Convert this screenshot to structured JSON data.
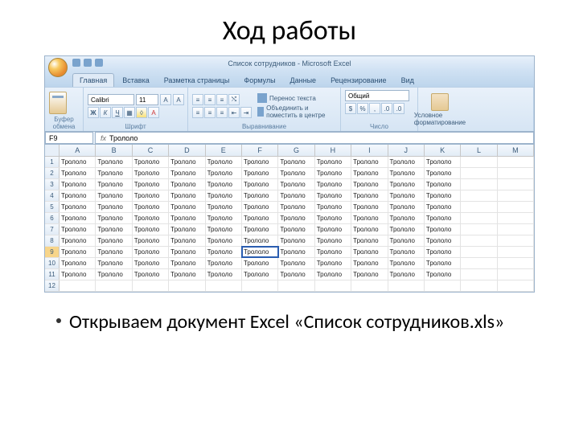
{
  "slide": {
    "title": "Ход работы",
    "bullet": "Открываем документ Excel «Список сотрудников.xls»"
  },
  "window": {
    "title": "Список сотрудников - Microsoft Excel"
  },
  "tabs": {
    "items": [
      {
        "label": "Главная",
        "active": true
      },
      {
        "label": "Вставка",
        "active": false
      },
      {
        "label": "Разметка страницы",
        "active": false
      },
      {
        "label": "Формулы",
        "active": false
      },
      {
        "label": "Данные",
        "active": false
      },
      {
        "label": "Рецензирование",
        "active": false
      },
      {
        "label": "Вид",
        "active": false
      }
    ]
  },
  "ribbon": {
    "clipboard_label": "Буфер обмена",
    "font_label": "Шрифт",
    "font_name": "Calibri",
    "font_size": "11",
    "bold": "Ж",
    "italic": "К",
    "underline": "Ч",
    "align_label": "Выравнивание",
    "wrap_text": "Перенос текста",
    "merge_center": "Объединить и поместить в центре",
    "number_label": "Число",
    "number_format": "Общий",
    "styles_label": "Условное форматирование"
  },
  "namebox": {
    "cell": "F9",
    "formula": "Трололо"
  },
  "columns": [
    "A",
    "B",
    "C",
    "D",
    "E",
    "F",
    "G",
    "H",
    "I",
    "J",
    "K",
    "L",
    "M"
  ],
  "rows": [
    1,
    2,
    3,
    4,
    5,
    6,
    7,
    8,
    9,
    10,
    11,
    12
  ],
  "cell_value": "Трололо",
  "active": {
    "row": 9,
    "col": "F"
  },
  "filled_cols": [
    "A",
    "B",
    "C",
    "D",
    "E",
    "F",
    "G",
    "H",
    "I",
    "J",
    "K"
  ],
  "filled_rows": 11
}
